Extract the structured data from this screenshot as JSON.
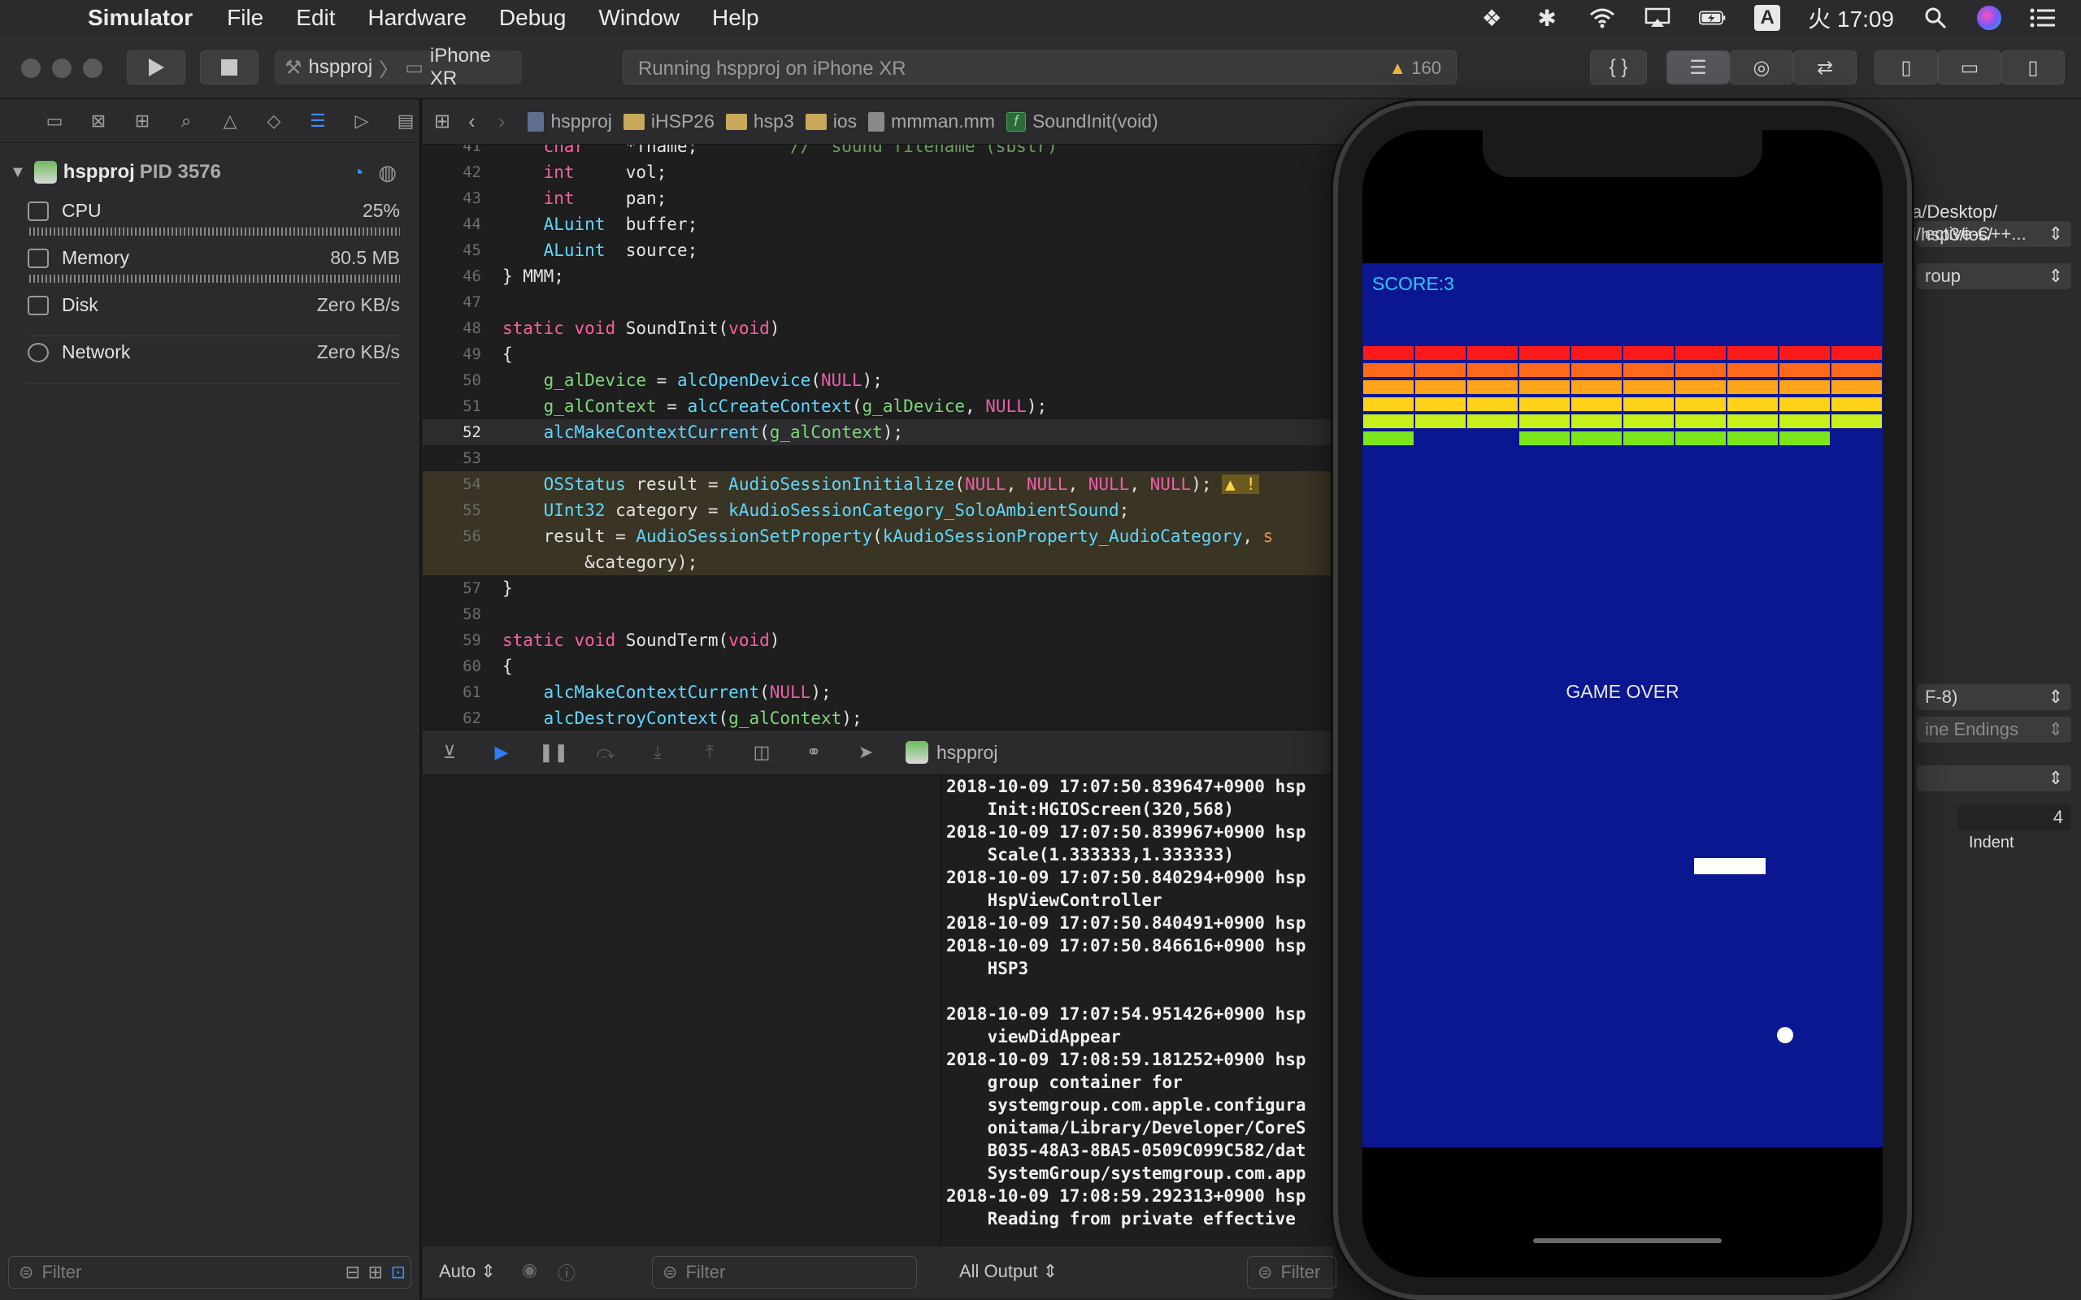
{
  "menubar": {
    "app_name": "Simulator",
    "items": [
      "File",
      "Edit",
      "Hardware",
      "Debug",
      "Window",
      "Help"
    ],
    "ime": "A",
    "clock": "火 17:09"
  },
  "toolbar": {
    "scheme_project": "hspproj",
    "scheme_device": "iPhone XR",
    "activity_text": "Running hspproj on iPhone XR",
    "warning_count": "160"
  },
  "navigator": {
    "process_name": "hspproj",
    "process_pid": "PID 3576",
    "gauges": [
      {
        "label": "CPU",
        "value": "25%"
      },
      {
        "label": "Memory",
        "value": "80.5 MB"
      },
      {
        "label": "Disk",
        "value": "Zero KB/s"
      },
      {
        "label": "Network",
        "value": "Zero KB/s"
      }
    ],
    "filter_placeholder": "Filter"
  },
  "jumpbar": {
    "crumbs": [
      "hspproj",
      "iHSP26",
      "hsp3",
      "ios",
      "mmman.mm",
      "SoundInit(void)"
    ]
  },
  "code": {
    "lines": [
      {
        "n": "41",
        "t": "    char    *fname;         //  sound filename (sbstr)"
      },
      {
        "n": "42",
        "t": "    int     vol;"
      },
      {
        "n": "43",
        "t": "    int     pan;"
      },
      {
        "n": "44",
        "t": "    ALuint  buffer;"
      },
      {
        "n": "45",
        "t": "    ALuint  source;"
      },
      {
        "n": "46",
        "t": "} MMM;"
      },
      {
        "n": "47",
        "t": ""
      },
      {
        "n": "48",
        "t": "static void SoundInit(void)"
      },
      {
        "n": "49",
        "t": "{"
      },
      {
        "n": "50",
        "t": "    g_alDevice = alcOpenDevice(NULL);"
      },
      {
        "n": "51",
        "t": "    g_alContext = alcCreateContext(g_alDevice, NULL);"
      },
      {
        "n": "52",
        "t": "    alcMakeContextCurrent(g_alContext);"
      },
      {
        "n": "53",
        "t": ""
      },
      {
        "n": "54",
        "t": "    OSStatus result = AudioSessionInitialize(NULL, NULL, NULL, NULL);"
      },
      {
        "n": "55",
        "t": "    UInt32 category = kAudioSessionCategory_SoloAmbientSound;"
      },
      {
        "n": "56",
        "t": "    result = AudioSessionSetProperty(kAudioSessionProperty_AudioCategory, s"
      },
      {
        "n": "",
        "t": "        &category);"
      },
      {
        "n": "57",
        "t": "}"
      },
      {
        "n": "58",
        "t": ""
      },
      {
        "n": "59",
        "t": "static void SoundTerm(void)"
      },
      {
        "n": "60",
        "t": "{"
      },
      {
        "n": "61",
        "t": "    alcMakeContextCurrent(NULL);"
      },
      {
        "n": "62",
        "t": "    alcDestroyContext(g_alContext);"
      }
    ]
  },
  "debugbar": {
    "target": "hspproj"
  },
  "console": {
    "lines": [
      "2018-10-09 17:07:50.839647+0900 hsp",
      "    Init:HGIOScreen(320,568)",
      "2018-10-09 17:07:50.839967+0900 hsp",
      "    Scale(1.333333,1.333333)",
      "2018-10-09 17:07:50.840294+0900 hsp",
      "    HspViewController",
      "2018-10-09 17:07:50.840491+0900 hsp",
      "2018-10-09 17:07:50.846616+0900 hsp",
      "    HSP3",
      "",
      "2018-10-09 17:07:54.951426+0900 hsp",
      "    viewDidAppear",
      "2018-10-09 17:08:59.181252+0900 hsp",
      "    group container for",
      "    systemgroup.com.apple.configura",
      "    onitama/Library/Developer/CoreS",
      "    B035-48A3-8BA5-0509C099C582/dat",
      "    SystemGroup/systemgroup.com.app",
      "2018-10-09 17:08:59.292313+0900 hsp",
      "    Reading from private effective"
    ]
  },
  "bottom": {
    "auto_label": "Auto",
    "filter_placeholder": "Filter",
    "output_label": "All Output",
    "console_filter": "Filter"
  },
  "inspector": {
    "language": "ective-C++...",
    "group": "roup",
    "path1": "a/Desktop/",
    "path2": "i/hsp3/ios/",
    "encoding": "F-8)",
    "line_endings": "ine Endings",
    "indent_value": "4",
    "indent_label": "Indent"
  },
  "game": {
    "score_text": "SCORE:3",
    "game_over_text": "GAME OVER",
    "brick_rows": [
      {
        "color": "#ff1a1a",
        "present": [
          1,
          1,
          1,
          1,
          1,
          1,
          1,
          1,
          1,
          1
        ]
      },
      {
        "color": "#ff6a1a",
        "present": [
          1,
          1,
          1,
          1,
          1,
          1,
          1,
          1,
          1,
          1
        ]
      },
      {
        "color": "#ffa51a",
        "present": [
          1,
          1,
          1,
          1,
          1,
          1,
          1,
          1,
          1,
          1
        ]
      },
      {
        "color": "#ffd21a",
        "present": [
          1,
          1,
          1,
          1,
          1,
          1,
          1,
          1,
          1,
          1
        ]
      },
      {
        "color": "#c8f01a",
        "present": [
          1,
          1,
          1,
          1,
          1,
          1,
          1,
          1,
          1,
          1
        ]
      },
      {
        "color": "#7be61a",
        "present": [
          1,
          0,
          0,
          1,
          1,
          1,
          1,
          1,
          1,
          0
        ]
      }
    ],
    "background": "#0b1791"
  }
}
